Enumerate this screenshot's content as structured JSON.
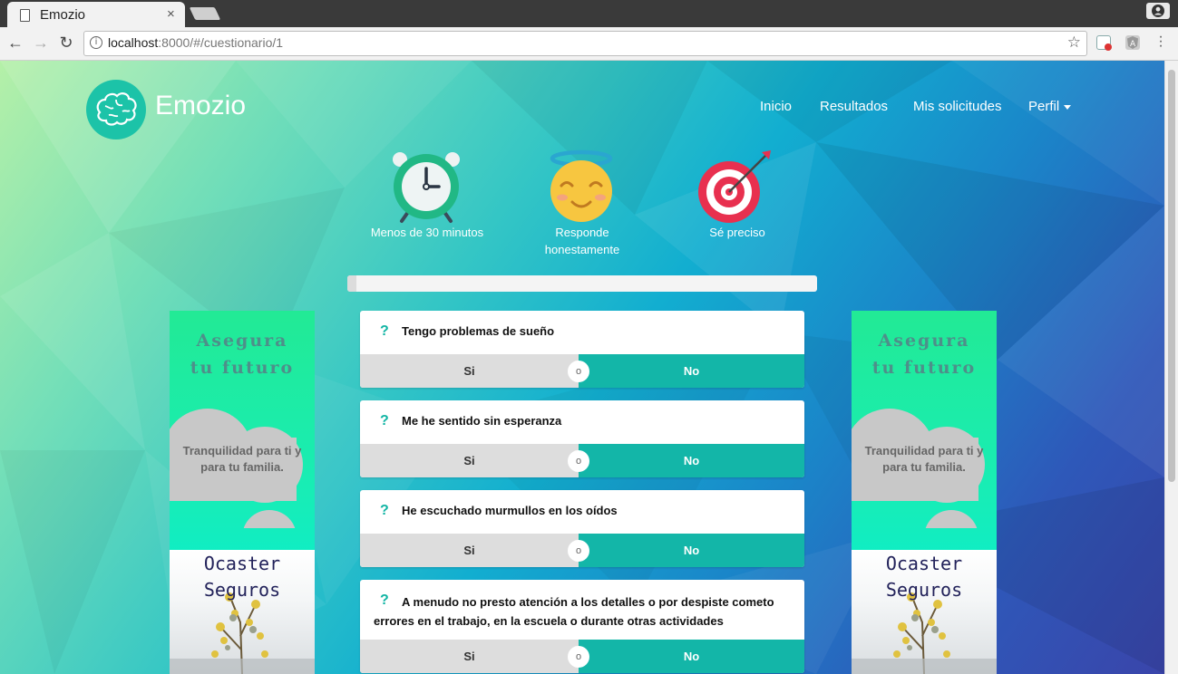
{
  "browser": {
    "tab_title": "Emozio",
    "tab_close": "×",
    "url_host": "localhost",
    "url_rest": ":8000/#/cuestionario/1"
  },
  "site": {
    "brand": "Emozio",
    "nav": [
      "Inicio",
      "Resultados",
      "Mis solicitudes",
      "Perfil"
    ]
  },
  "tips": [
    {
      "label": "Menos de 30 minutos",
      "icon": "alarm-clock-icon"
    },
    {
      "label": "Responde honestamente",
      "icon": "angel-face-icon"
    },
    {
      "label": "Sé preciso",
      "icon": "target-icon"
    }
  ],
  "progress": {
    "value": 0.02
  },
  "questions": [
    {
      "text": "Tengo problemas de sueño",
      "yes": "Si",
      "or": "o",
      "no": "No"
    },
    {
      "text": "Me he sentido sin esperanza",
      "yes": "Si",
      "or": "o",
      "no": "No"
    },
    {
      "text": "He escuchado murmullos en los oídos",
      "yes": "Si",
      "or": "o",
      "no": "No"
    },
    {
      "text": "A menudo no presto atención a los detalles o por despiste cometo errores en el trabajo, en la escuela o durante otras actividades",
      "yes": "Si",
      "or": "o",
      "no": "No"
    }
  ],
  "ad": {
    "headline_1": "Asegura",
    "headline_2": "tu futuro",
    "text": "Tranquilidad para ti y para tu familia.",
    "brand_1": "Ocaster",
    "brand_2": "Seguros"
  },
  "colors": {
    "accent": "#13b6a8",
    "answer_yes_bg": "#dddddd",
    "target_red": "#e8304f"
  }
}
